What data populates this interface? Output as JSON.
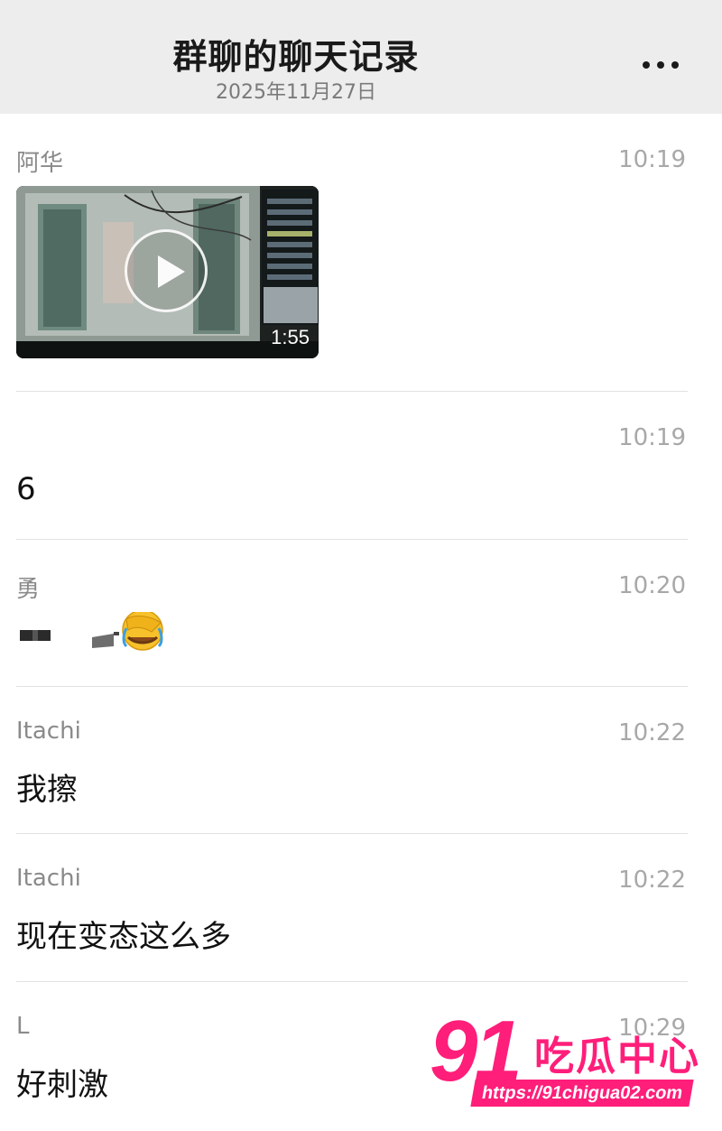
{
  "header": {
    "title": "群聊的聊天记录",
    "date": "2025年11月27日",
    "more_icon": "more-dots-icon"
  },
  "messages": [
    {
      "sender": "阿华",
      "time": "10:19",
      "type": "video",
      "video": {
        "duration": "1:55",
        "play_icon": "play-icon"
      }
    },
    {
      "sender": "",
      "time": "10:19",
      "type": "text",
      "text": "6"
    },
    {
      "sender": "勇",
      "time": "10:20",
      "type": "emoji",
      "emoji_icon": "facepalm-emoji-icon"
    },
    {
      "sender": "Itachi",
      "time": "10:22",
      "type": "text",
      "text": "我擦"
    },
    {
      "sender": "Itachi",
      "time": "10:22",
      "type": "text",
      "text": "现在变态这么多"
    },
    {
      "sender": "L",
      "time": "10:29",
      "type": "text",
      "text": "好刺激"
    }
  ],
  "watermark": {
    "number": "91",
    "name": "吃瓜中心",
    "url": "https://91chigua02.com",
    "color": "#ff1e7a"
  }
}
